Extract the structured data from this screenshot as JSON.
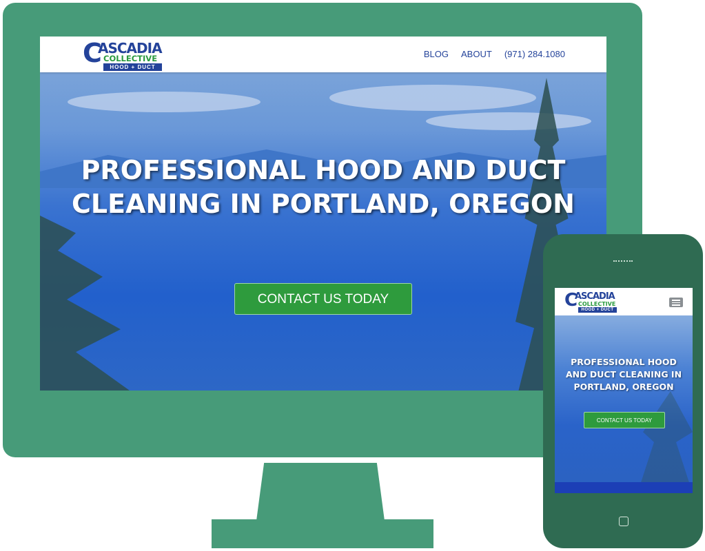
{
  "brand": {
    "logo_c": "C",
    "logo_name": "ASCADIA",
    "logo_sub": "COLLECTIVE",
    "logo_tag": "HOOD + DUCT"
  },
  "nav": {
    "items": [
      {
        "label": "BLOG"
      },
      {
        "label": "ABOUT"
      },
      {
        "label": "(971) 284.1080"
      }
    ]
  },
  "hero": {
    "title": "PROFESSIONAL HOOD AND DUCT CLEANING IN PORTLAND, OREGON",
    "cta": "CONTACT US TODAY"
  },
  "mobile": {
    "title": "PROFESSIONAL HOOD AND DUCT CLEANING IN PORTLAND, OREGON",
    "cta": "CONTACT US TODAY",
    "menu_icon": "hamburger-icon"
  },
  "colors": {
    "device": "#479b79",
    "phone": "#2f6b52",
    "brand_blue": "#24439a",
    "brand_green": "#2a9a3e",
    "cta_green": "#2e9b3d"
  }
}
